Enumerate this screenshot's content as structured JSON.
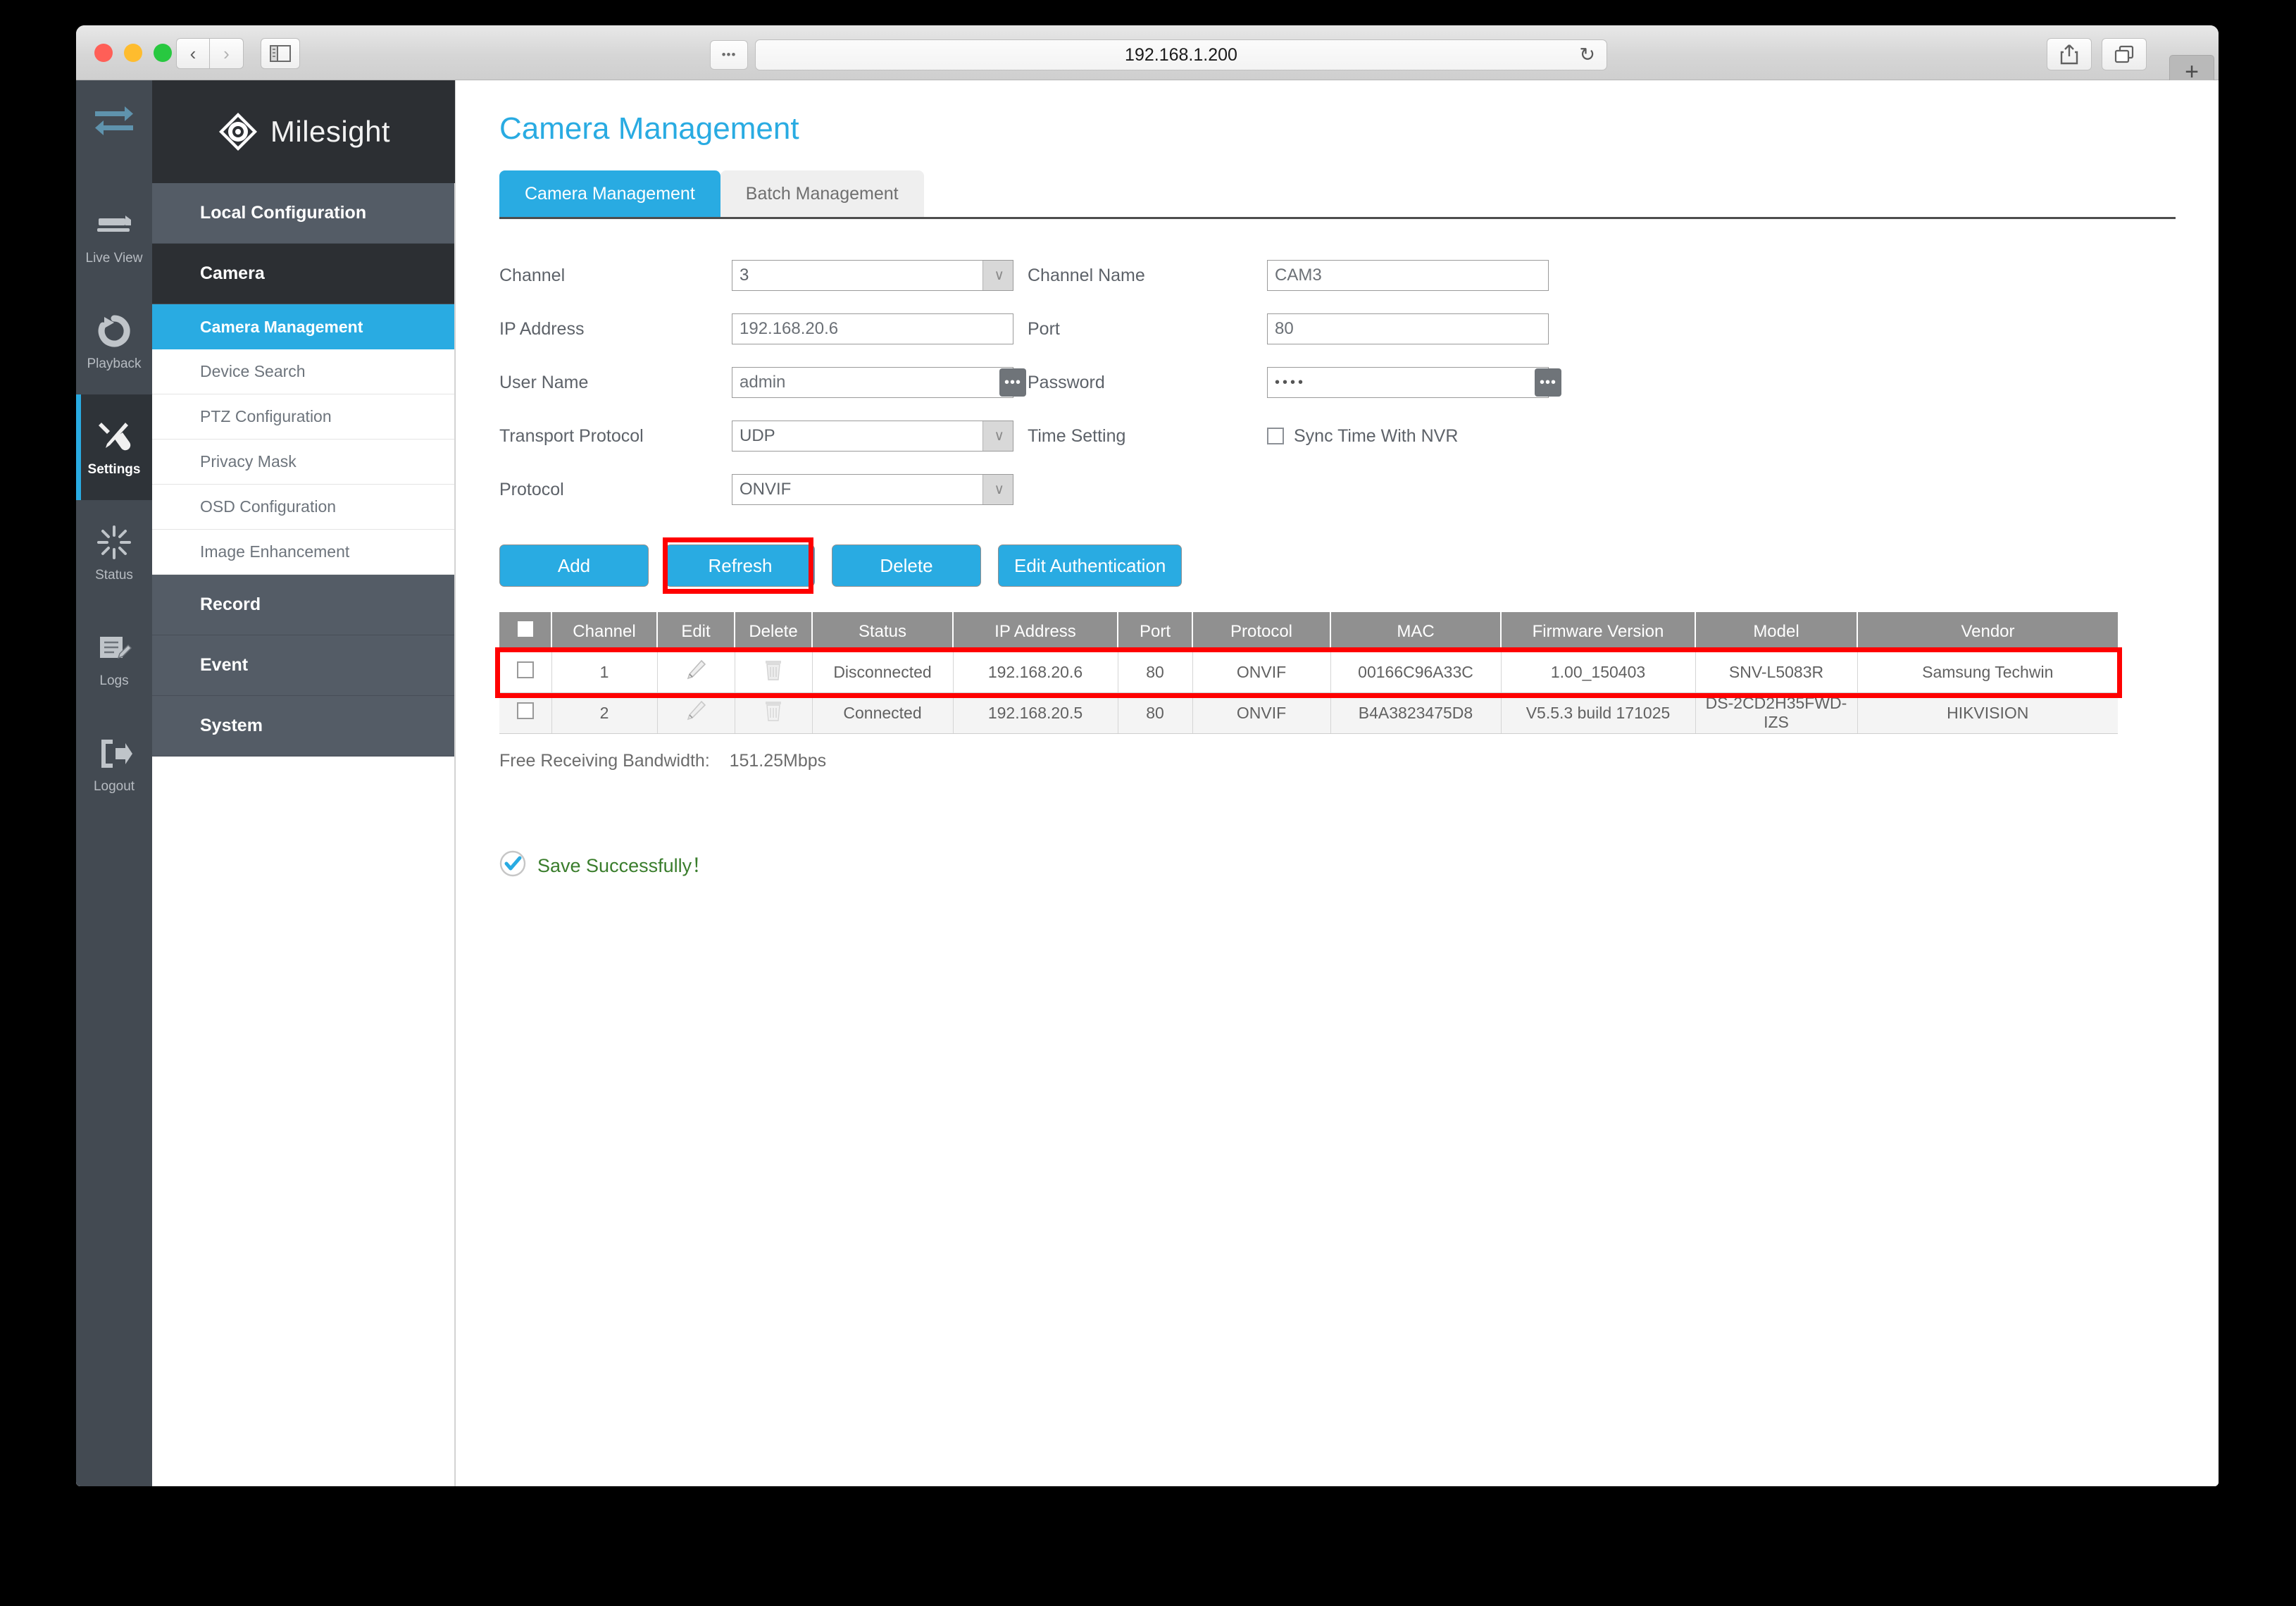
{
  "browser": {
    "url": "192.168.1.200",
    "back_label": "‹",
    "forward_label": "›",
    "reader_label": "•••",
    "reload_label": "↻",
    "newtab_label": "+"
  },
  "brand": {
    "name": "Milesight"
  },
  "rail": {
    "items": [
      {
        "label": "Live View",
        "icon": "live-view-icon",
        "active": false
      },
      {
        "label": "Playback",
        "icon": "playback-icon",
        "active": false
      },
      {
        "label": "Settings",
        "icon": "settings-icon",
        "active": true
      },
      {
        "label": "Status",
        "icon": "status-icon",
        "active": false
      },
      {
        "label": "Logs",
        "icon": "logs-icon",
        "active": false
      },
      {
        "label": "Logout",
        "icon": "logout-icon",
        "active": false
      }
    ]
  },
  "menu": {
    "local_configuration": "Local Configuration",
    "camera": "Camera",
    "camera_management": "Camera Management",
    "device_search": "Device Search",
    "ptz_configuration": "PTZ Configuration",
    "privacy_mask": "Privacy Mask",
    "osd_configuration": "OSD Configuration",
    "image_enhancement": "Image Enhancement",
    "record": "Record",
    "event": "Event",
    "system": "System"
  },
  "main": {
    "title": "Camera Management",
    "tabs": [
      {
        "label": "Camera Management",
        "active": true
      },
      {
        "label": "Batch Management",
        "active": false
      }
    ],
    "form": {
      "channel_label": "Channel",
      "channel_value": "3",
      "ip_label": "IP Address",
      "ip_value": "192.168.20.6",
      "user_label": "User Name",
      "user_value": "admin",
      "transport_label": "Transport Protocol",
      "transport_value": "UDP",
      "protocol_label": "Protocol",
      "protocol_value": "ONVIF",
      "channel_name_label": "Channel Name",
      "channel_name_value": "CAM3",
      "port_label": "Port",
      "port_value": "80",
      "password_label": "Password",
      "password_value": "••••",
      "time_setting_label": "Time Setting",
      "sync_time_label": "Sync Time With NVR",
      "dots_label": "•••",
      "caret": "∨"
    },
    "buttons": [
      {
        "label": "Add",
        "highlighted": false
      },
      {
        "label": "Refresh",
        "highlighted": true
      },
      {
        "label": "Delete",
        "highlighted": false
      },
      {
        "label": "Edit Authentication",
        "highlighted": false
      }
    ],
    "table": {
      "columns": [
        "",
        "Channel",
        "Edit",
        "Delete",
        "Status",
        "IP Address",
        "Port",
        "Protocol",
        "MAC",
        "Firmware Version",
        "Model",
        "Vendor"
      ],
      "rows": [
        {
          "channel": "1",
          "status": "Disconnected",
          "ip": "192.168.20.6",
          "port": "80",
          "protocol": "ONVIF",
          "mac": "00166C96A33C",
          "firmware": "1.00_150403",
          "model": "SNV-L5083R",
          "vendor": "Samsung Techwin",
          "highlighted": true
        },
        {
          "channel": "2",
          "status": "Connected",
          "ip": "192.168.20.5",
          "port": "80",
          "protocol": "ONVIF",
          "mac": "B4A3823475D8",
          "firmware": "V5.5.3 build 171025",
          "model": "DS-2CD2H35FWD-IZS",
          "vendor": "HIKVISION",
          "highlighted": false
        }
      ]
    },
    "bandwidth_label": "Free Receiving Bandwidth:",
    "bandwidth_value": "151.25Mbps",
    "save_message": "Save Successfully！"
  },
  "colors": {
    "accent": "#29abe2",
    "highlight": "#ff0000",
    "success": "#3a7d2c",
    "rail_bg": "#434a52",
    "menu_group_bg": "#545c66"
  }
}
